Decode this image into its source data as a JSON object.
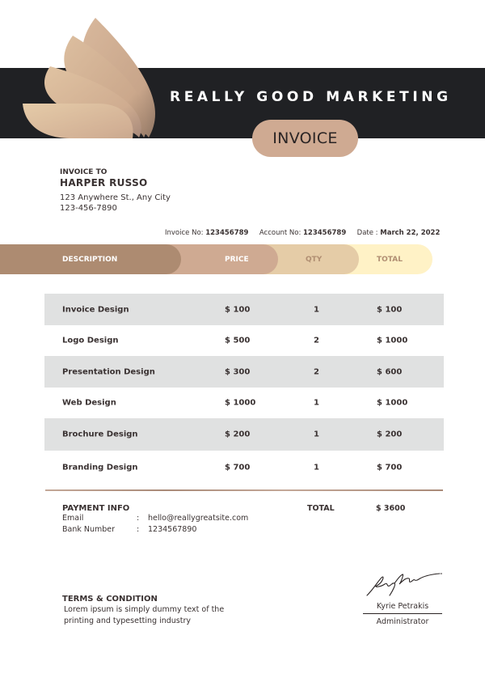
{
  "brand": {
    "company_name": "REALLY GOOD MARKETING",
    "logo_icon": "wing-feathers-logo-icon",
    "colors": {
      "band": "#202124",
      "accent_dark": "#ad8b71",
      "accent": "#cfaa92",
      "accent_light": "#e5cca7",
      "accent_pale": "#fff2c6",
      "row_shade": "#e0e1e1",
      "text": "#3a3232"
    }
  },
  "document": {
    "title": "INVOICE"
  },
  "bill_to": {
    "label": "INVOICE TO",
    "name": "HARPER RUSSO",
    "address": "123 Anywhere St., Any City",
    "phone": "123-456-7890"
  },
  "meta": {
    "invoice_no_label": "Invoice No:",
    "invoice_no": "123456789",
    "account_no_label": "Account No:",
    "account_no": "123456789",
    "date_label": "Date :",
    "date": "March 22, 2022"
  },
  "table": {
    "headers": {
      "description": "DESCRIPTION",
      "price": "PRICE",
      "qty": "QTY",
      "total": "TOTAL"
    },
    "rows": [
      {
        "description": "Invoice Design",
        "price": "$ 100",
        "qty": "1",
        "total": "$ 100"
      },
      {
        "description": "Logo Design",
        "price": "$ 500",
        "qty": "2",
        "total": "$ 1000"
      },
      {
        "description": "Presentation Design",
        "price": "$ 300",
        "qty": "2",
        "total": "$ 600"
      },
      {
        "description": "Web Design",
        "price": "$ 1000",
        "qty": "1",
        "total": "$ 1000"
      },
      {
        "description": "Brochure Design",
        "price": "$ 200",
        "qty": "1",
        "total": "$ 200"
      },
      {
        "description": "Branding Design",
        "price": "$ 700",
        "qty": "1",
        "total": "$ 700"
      }
    ]
  },
  "payment": {
    "title": "PAYMENT INFO",
    "email_label": "Email",
    "email": "hello@reallygreatsite.com",
    "bank_label": "Bank Number",
    "bank": "1234567890",
    "separator": ":"
  },
  "summary": {
    "total_label": "TOTAL",
    "total_value": "$ 3600"
  },
  "terms": {
    "title": "TERMS & CONDITION",
    "line1": "Lorem ipsum is simply dummy text of the",
    "line2": "printing and typesetting industry"
  },
  "signature": {
    "icon": "handwritten-signature-icon",
    "name": "Kyrie Petrakis",
    "role": "Administrator"
  }
}
